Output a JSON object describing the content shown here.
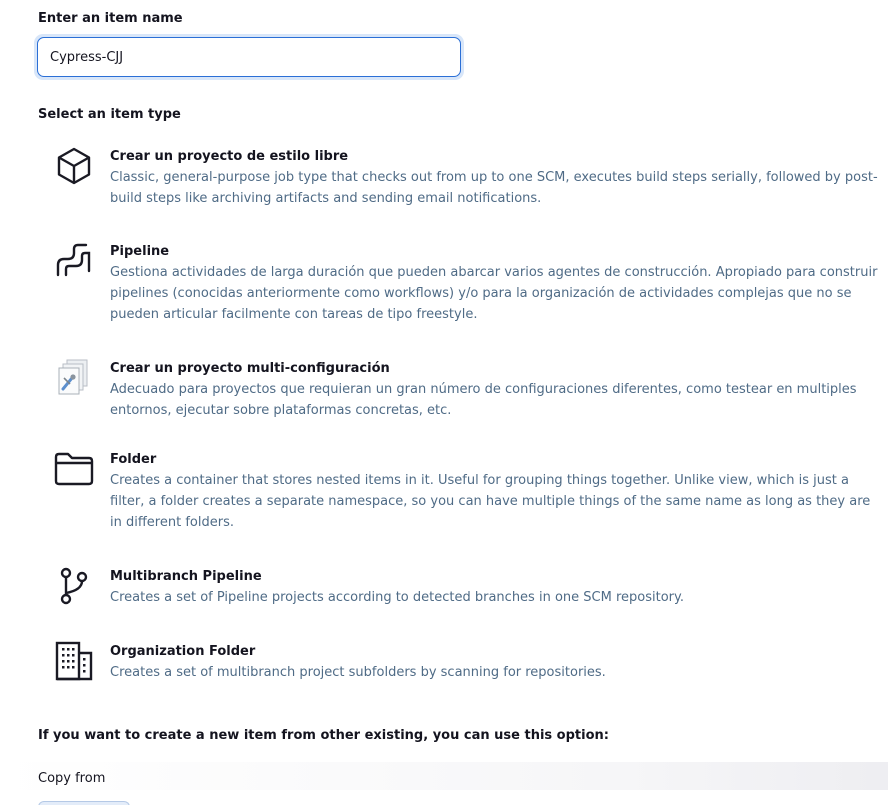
{
  "form": {
    "name_label": "Enter an item name",
    "name_value": "Cypress-CJJ",
    "type_label": "Select an item type"
  },
  "items": [
    {
      "title": "Crear un proyecto de estilo libre",
      "description": "Classic, general-purpose job type that checks out from up to one SCM, executes build steps serially, followed by post-build steps like archiving artifacts and sending email notifications.",
      "icon": "cube-icon"
    },
    {
      "title": "Pipeline",
      "description": "Gestiona actividades de larga duración que pueden abarcar varios agentes de construcción. Apropiado para construir pipelines (conocidas anteriormente como workflows) y/o para la organización de actividades complejas que no se pueden articular facilmente con tareas de tipo freestyle.",
      "icon": "pipeline-icon"
    },
    {
      "title": "Crear un proyecto multi-configuración",
      "description": "Adecuado para proyectos que requieran un gran número de configuraciones diferentes, como testear en multiples entornos, ejecutar sobre plataformas concretas, etc.",
      "icon": "multi-config-icon"
    },
    {
      "title": "Folder",
      "description": "Creates a container that stores nested items in it. Useful for grouping things together. Unlike view, which is just a filter, a folder creates a separate namespace, so you can have multiple things of the same name as long as they are in different folders.",
      "icon": "folder-icon"
    },
    {
      "title": "Multibranch Pipeline",
      "description": "Creates a set of Pipeline projects according to detected branches in one SCM repository.",
      "icon": "branch-icon"
    },
    {
      "title": "Organization Folder",
      "description": "Creates a set of multibranch project subfolders by scanning for repositories.",
      "icon": "building-icon"
    }
  ],
  "copy": {
    "question": "If you want to create a new item from other existing, you can use this option:",
    "label": "Copy from"
  }
}
